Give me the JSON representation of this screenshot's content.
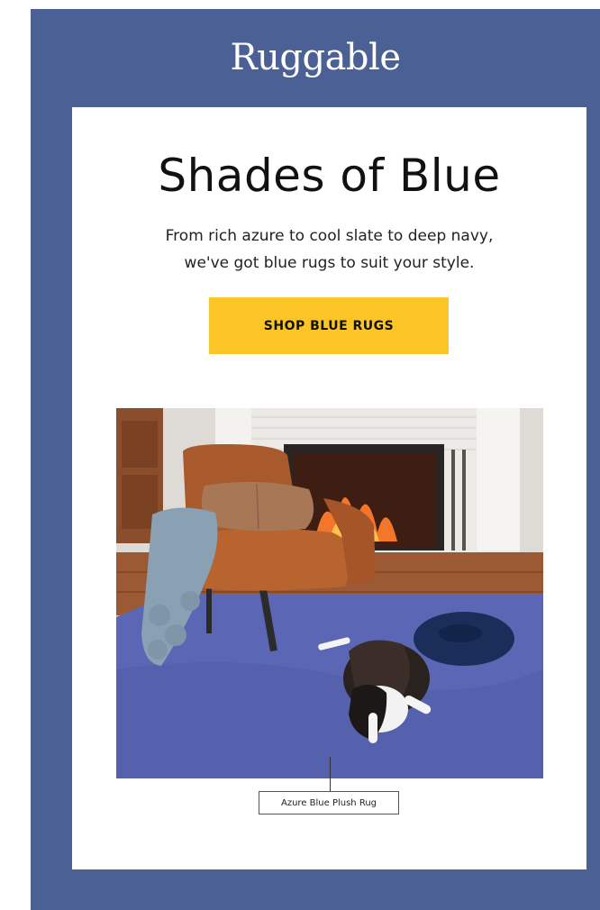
{
  "brand": {
    "name": "Ruggable",
    "frame_color": "#4b6196"
  },
  "hero": {
    "headline": "Shades of Blue",
    "subcopy_line1": "From rich azure to cool slate to deep navy,",
    "subcopy_line2": "we've got blue rugs to suit your style."
  },
  "cta": {
    "label": "SHOP BLUE RUGS",
    "color": "#fcc527"
  },
  "product": {
    "caption": "Azure Blue Plush Rug",
    "rug_color": "#5b66b4"
  }
}
